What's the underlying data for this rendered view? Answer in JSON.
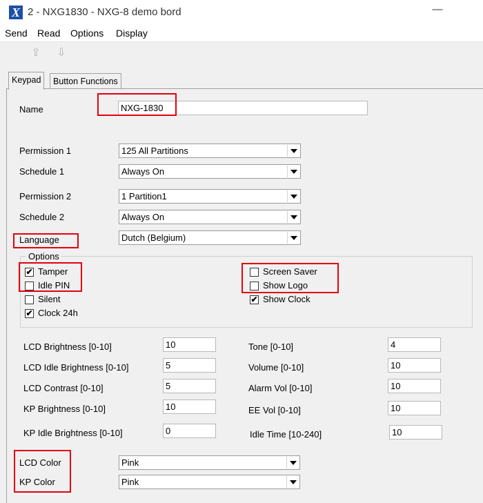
{
  "window": {
    "title": "2 - NXG1830 - NXG-8 demo bord",
    "app_icon": "X",
    "minimize": "—"
  },
  "menu": [
    "Send",
    "Read",
    "Options",
    "Display"
  ],
  "toolbar": {
    "upload_icon": "⇪",
    "download_icon": "⇩"
  },
  "tabs": [
    {
      "label": "Keypad",
      "active": true
    },
    {
      "label": "Button Functions",
      "active": false
    }
  ],
  "form": {
    "name_label": "Name",
    "name_value": "NXG-1830",
    "permission1_label": "Permission 1",
    "permission1_value": "125 All Partitions",
    "schedule1_label": "Schedule 1",
    "schedule1_value": "Always On",
    "permission2_label": "Permission 2",
    "permission2_value": "1 Partition1",
    "schedule2_label": "Schedule 2",
    "schedule2_value": "Always On",
    "language_label": "Language",
    "language_value": "Dutch (Belgium)"
  },
  "options": {
    "title": "Options",
    "tamper": {
      "label": "Tamper",
      "checked": true,
      "mark": "✔"
    },
    "idle_pin": {
      "label": "Idle PIN",
      "checked": false,
      "mark": ""
    },
    "silent": {
      "label": "Silent",
      "checked": false,
      "mark": ""
    },
    "clock24h": {
      "label": "Clock 24h",
      "checked": true,
      "mark": "✔"
    },
    "screen_saver": {
      "label": "Screen Saver",
      "checked": false,
      "mark": ""
    },
    "show_logo": {
      "label": "Show Logo",
      "checked": false,
      "mark": ""
    },
    "show_clock": {
      "label": "Show Clock",
      "checked": true,
      "mark": "✔"
    }
  },
  "settings": {
    "lcd_brightness": {
      "label": "LCD Brightness [0-10]",
      "value": "10"
    },
    "lcd_idle_brightness": {
      "label": "LCD Idle Brightness [0-10]",
      "value": "5"
    },
    "lcd_contrast": {
      "label": "LCD Contrast [0-10]",
      "value": "5"
    },
    "kp_brightness": {
      "label": "KP Brightness [0-10]",
      "value": "10"
    },
    "kp_idle_brightness": {
      "label": "KP Idle Brightness [0-10]",
      "value": "0"
    },
    "tone": {
      "label": "Tone [0-10]",
      "value": "4"
    },
    "volume": {
      "label": "Volume [0-10]",
      "value": "10"
    },
    "alarm_vol": {
      "label": "Alarm Vol [0-10]",
      "value": "10"
    },
    "ee_vol": {
      "label": "EE Vol [0-10]",
      "value": "10"
    },
    "idle_time": {
      "label": "Idle Time [10-240]",
      "value": "10"
    }
  },
  "colors_section": {
    "lcd_color_label": "LCD Color",
    "lcd_color_value": "Pink",
    "kp_color_label": "KP Color",
    "kp_color_value": "Pink"
  },
  "highlight_color": "#e3000f"
}
